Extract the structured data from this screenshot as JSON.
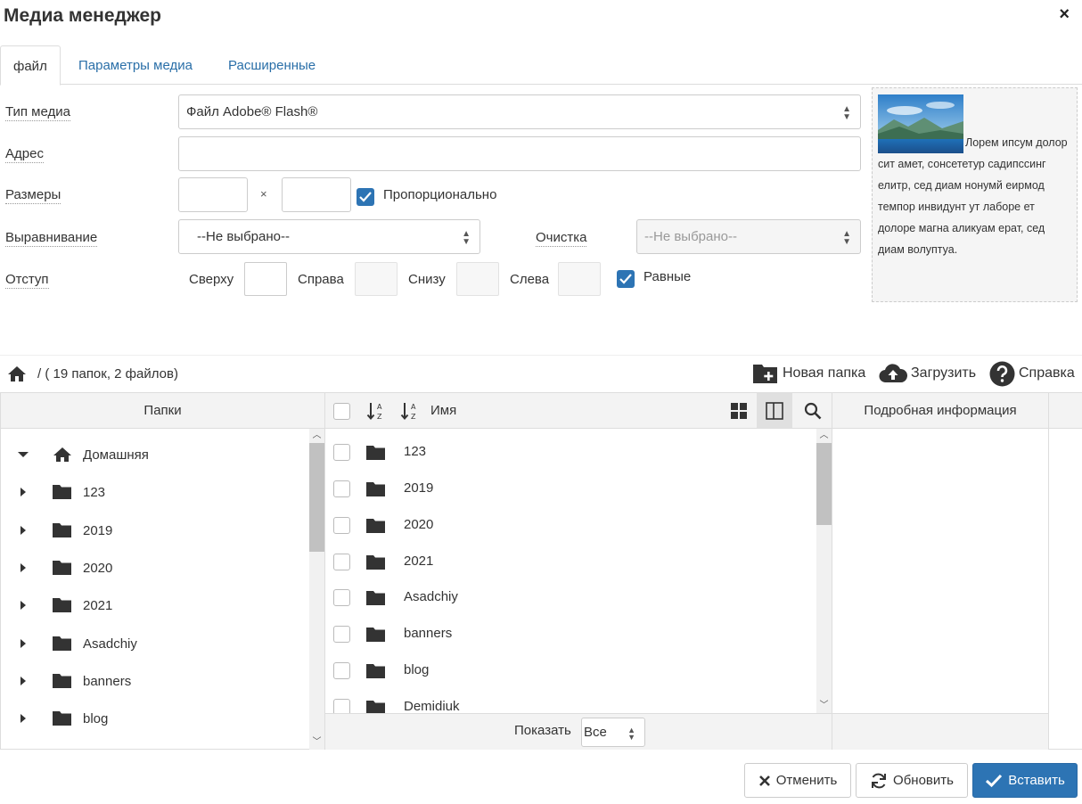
{
  "dialog": {
    "title": "Медиа менеджер",
    "close_icon": "×"
  },
  "tabs": [
    {
      "label": "файл"
    },
    {
      "label": "Параметры медиа"
    },
    {
      "label": "Расширенные"
    }
  ],
  "form": {
    "media_type": {
      "label": "Тип медиа",
      "value": "Файл Adobe® Flash®"
    },
    "address": {
      "label": "Адрес",
      "value": ""
    },
    "sizes": {
      "label": "Размеры",
      "times": "×",
      "proportional": "Пропорционально",
      "proportional_checked": true
    },
    "align": {
      "label": "Выравнивание",
      "value": "--Не выбрано--"
    },
    "clear": {
      "label": "Очистка",
      "value": "--Не выбрано--"
    },
    "indent": {
      "label": "Отступ",
      "top": "Сверху",
      "right": "Справа",
      "bottom": "Снизу",
      "left": "Слева",
      "equal": "Равные",
      "equal_checked": true
    }
  },
  "preview": {
    "text": "Лорем ипсум долор сит амет, сонсететур садипссинг елитр, сед диам нонумй еирмод темпор инвидунт ут лаборе ет долоре магна аликуам ерат, сед диам волуптуа."
  },
  "toolbar": {
    "path": "/ ( 19 папок, 2 файлов)",
    "new_folder": "Новая папка",
    "upload": "Загрузить",
    "help": "Справка"
  },
  "folders_pane": {
    "header": "Папки",
    "root": "Домашняя",
    "items": [
      "123",
      "2019",
      "2020",
      "2021",
      "Asadchiy",
      "banners",
      "blog"
    ]
  },
  "files_pane": {
    "sort_label": "Имя",
    "items": [
      "123",
      "2019",
      "2020",
      "2021",
      "Asadchiy",
      "banners",
      "blog",
      "Demidiuk"
    ],
    "show_label": "Показать",
    "show_value": "Все"
  },
  "details_pane": {
    "header": "Подробная информация"
  },
  "buttons": {
    "cancel": "Отменить",
    "refresh": "Обновить",
    "insert": "Вставить"
  },
  "colors": {
    "accent": "#2d74b4",
    "link": "#2a6fa8"
  }
}
